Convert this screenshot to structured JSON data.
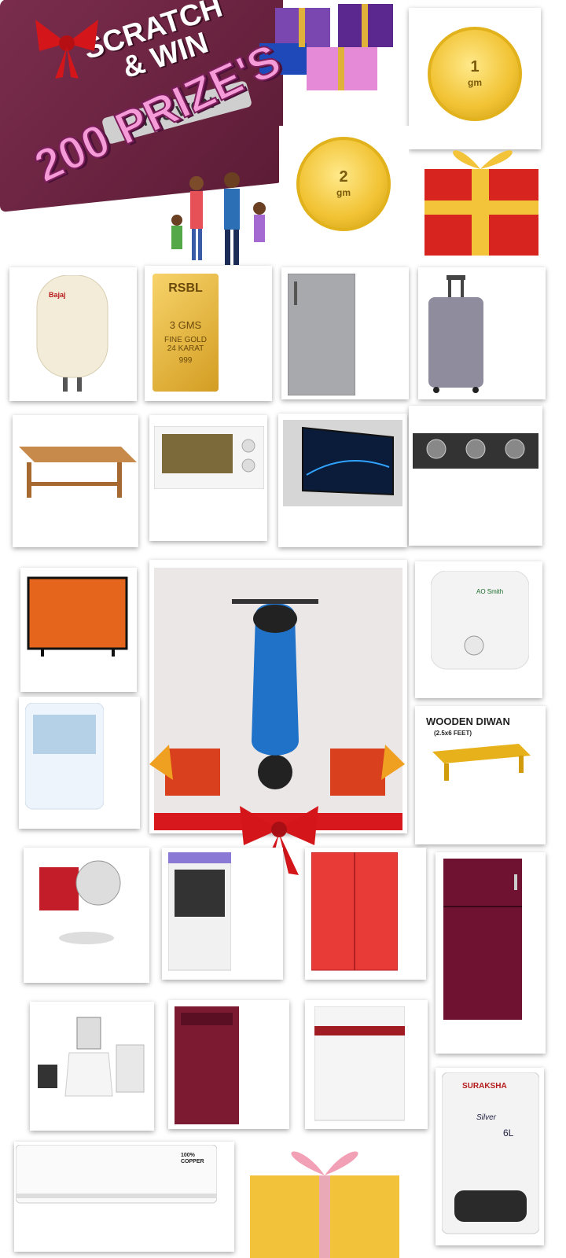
{
  "header": {
    "scratch_line1": "SCRATCH",
    "scratch_line2": "& WIN",
    "you_won": "YOU WON",
    "prizes_banner": "200 PRIZE'S"
  },
  "coins": {
    "coin1_value": "1",
    "coin1_unit": "gm",
    "coin2_value": "2",
    "coin2_unit": "gm"
  },
  "gold_bar": {
    "brand": "RSBL",
    "weight": "3 GMS",
    "line1": "FINE GOLD",
    "line2": "24 KARAT",
    "purity": "999"
  },
  "products": {
    "water_heater_brand": "Bajaj",
    "diwan_title": "WOODEN DIWAN",
    "diwan_size": "(2.5x6 FEET)",
    "ac_badge": "100% COPPER",
    "geyser_brand": "SURAKSHA",
    "geyser_model": "Silver",
    "geyser_capacity": "6L",
    "heater2_brand": "AO Smith"
  }
}
